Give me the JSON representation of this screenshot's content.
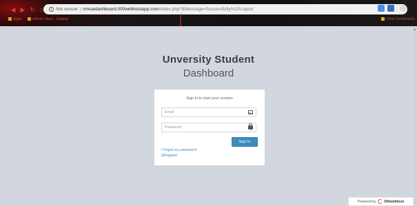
{
  "browser": {
    "security_label": "Not secure",
    "url_host": "nmuaidashboard.000webhostapp.com",
    "url_path": "/index.php?&Message=Successfully%20Logout",
    "bookmarks": [
      {
        "label": "Apps"
      },
      {
        "label": "Infinity Math - Gabriel"
      }
    ],
    "bookmarks_right": {
      "label": "Other bookmarks"
    }
  },
  "page": {
    "title_line1": "Unversity Student",
    "title_line2": "Dashboard"
  },
  "login": {
    "message": "Sign in to start your session",
    "email_placeholder": "Email",
    "email_value": "",
    "password_placeholder": "Password",
    "password_value": "",
    "signin_label": "Sign In",
    "forgot_label": "I forgot my password",
    "register_label": "||Register"
  },
  "footer": {
    "powered_label": "Powered by",
    "brand": "000webhost"
  },
  "colors": {
    "accent": "#3c8dbc",
    "background": "#d2d6de"
  }
}
